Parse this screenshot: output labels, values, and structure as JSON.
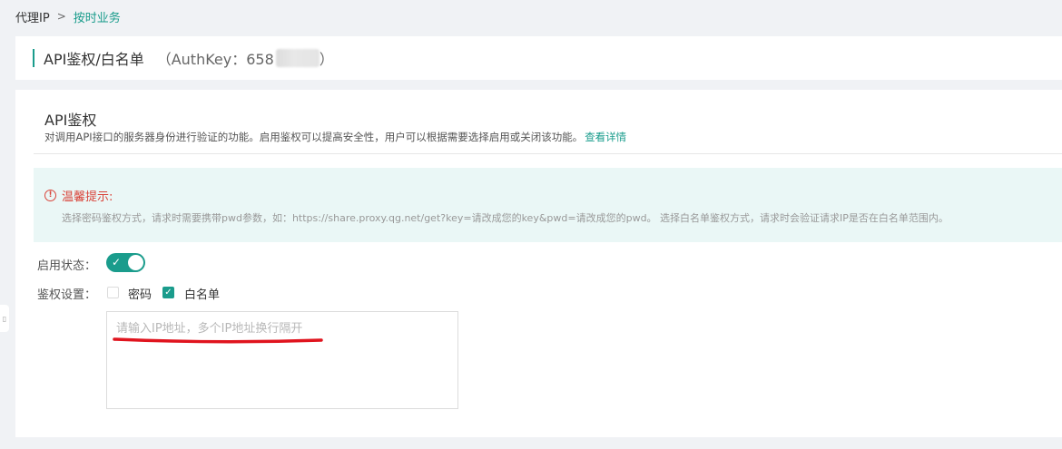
{
  "breadcrumb": {
    "root": "代理IP",
    "separator": ">",
    "current": "按时业务"
  },
  "header": {
    "title": "API鉴权/白名单",
    "authkey_prefix": "（AuthKey：658",
    "authkey_suffix": "）"
  },
  "section": {
    "title": "API鉴权",
    "description": "对调用API接口的服务器身份进行验证的功能。启用鉴权可以提高安全性，用户可以根据需要选择启用或关闭该功能。",
    "details_link": "查看详情"
  },
  "tip": {
    "icon": "alert-circle-icon",
    "title": "温馨提示:",
    "text": "选择密码鉴权方式，请求时需要携带pwd参数，如：https://share.proxy.qg.net/get?key=请改成您的key&pwd=请改成您的pwd。 选择白名单鉴权方式，请求时会验证请求IP是否在白名单范围内。"
  },
  "form": {
    "status_label": "启用状态：",
    "status_enabled": true,
    "auth_label": "鉴权设置：",
    "options": [
      {
        "label": "密码",
        "checked": false
      },
      {
        "label": "白名单",
        "checked": true
      }
    ],
    "ip_placeholder": "请输入IP地址，多个IP地址换行隔开",
    "ip_value": ""
  },
  "colors": {
    "accent": "#1a9c8c",
    "warning": "#d9443a",
    "tip_bg": "#eaf7f6"
  }
}
